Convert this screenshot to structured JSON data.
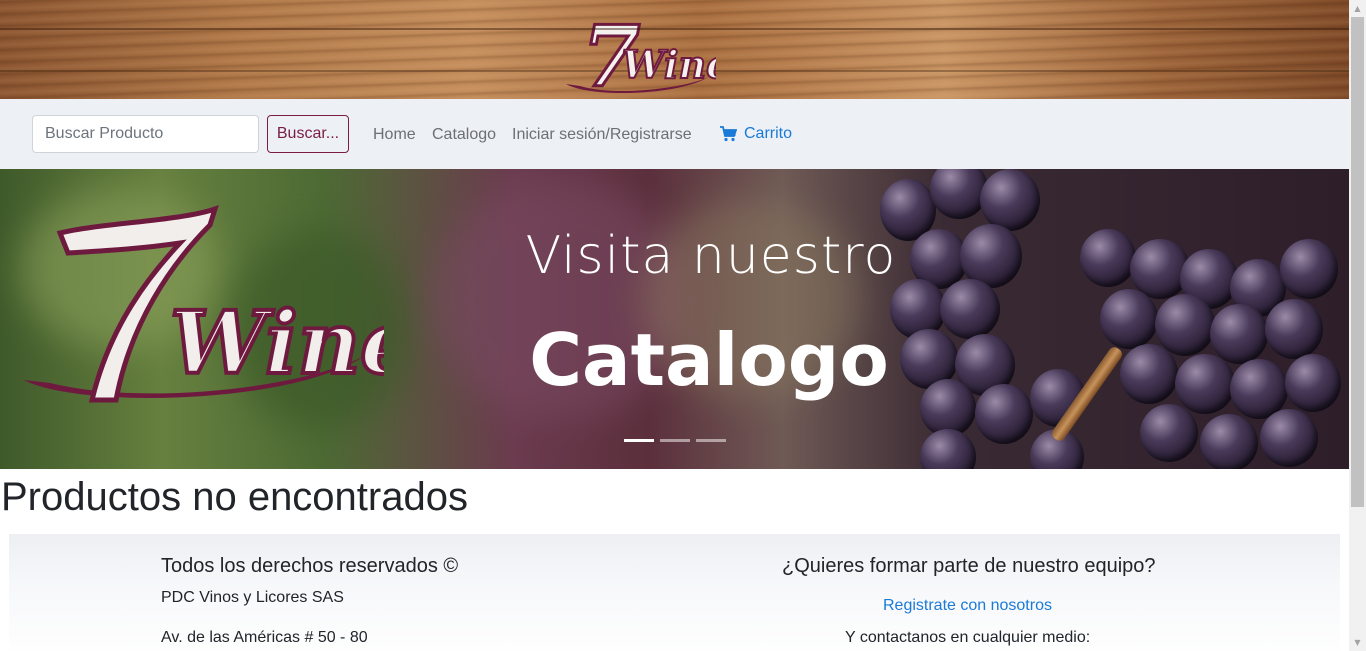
{
  "header": {
    "logo_number": "7",
    "logo_text": "Wine",
    "logo_icon": "seven-wine-logo"
  },
  "navbar": {
    "search_placeholder": "Buscar Producto",
    "search_button": "Buscar...",
    "links": {
      "home": "Home",
      "catalog": "Catalogo",
      "login": "Iniciar sesión/Registrarse",
      "cart": "Carrito"
    },
    "cart_icon": "shopping-cart-icon"
  },
  "carousel": {
    "caption_line1": "Visita nuestro",
    "caption_line2": "Catalogo",
    "prev_icon": "chevron-left-icon",
    "next_icon": "chevron-right-icon",
    "slides": 3,
    "active_slide": 1
  },
  "main": {
    "heading": "Productos no encontrados"
  },
  "footer": {
    "left_title": "Todos los derechos reservados ©",
    "company": "PDC Vinos y Licores SAS",
    "address": "Av. de las Américas # 50 - 80",
    "right_title": "¿Quieres formar parte de nuestro equipo?",
    "register_link": "Registrate con nosotros",
    "contact_text": "Y contactanos en cualquier medio:"
  },
  "colors": {
    "brand": "#7a1c46",
    "link": "#1a7ad8",
    "navbar_bg": "#edf0f5"
  }
}
